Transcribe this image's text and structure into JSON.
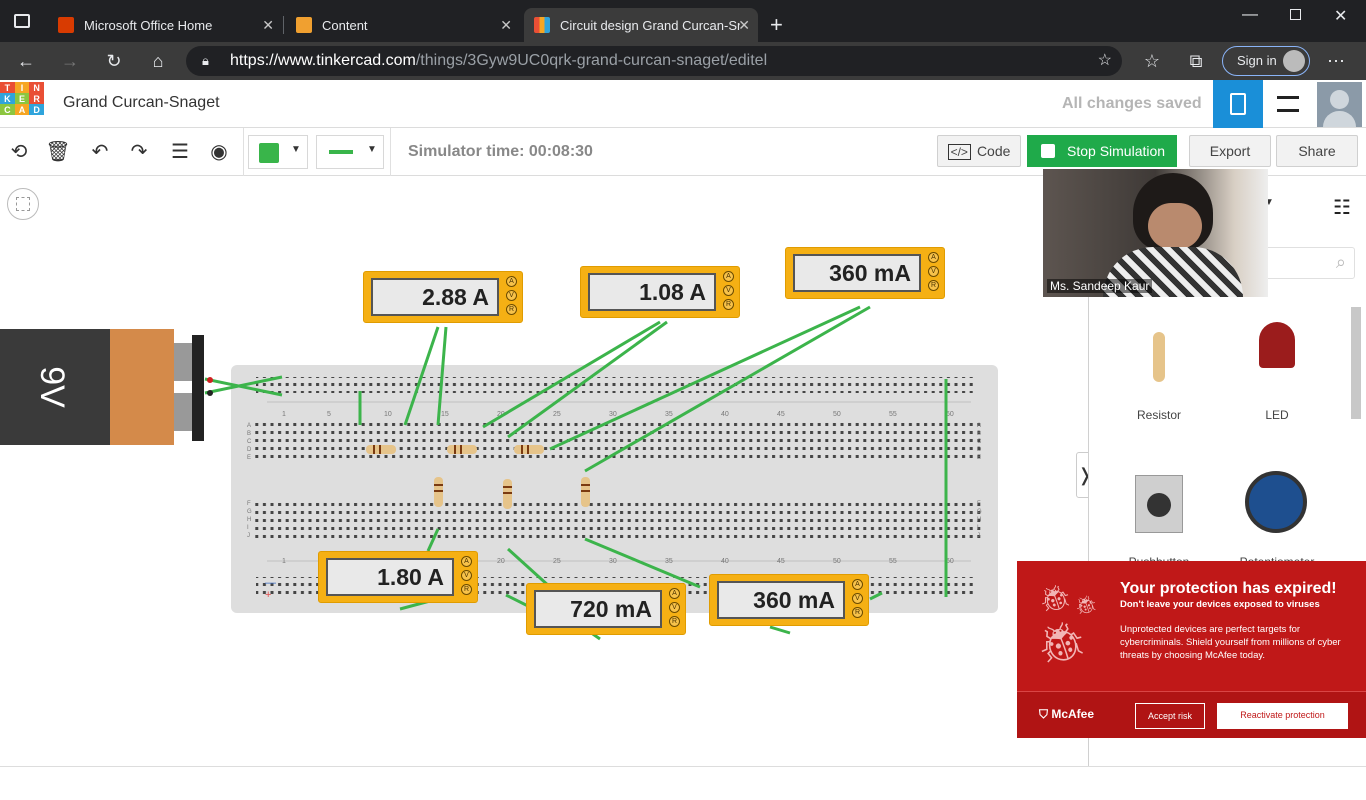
{
  "browser": {
    "tabs": [
      {
        "label": "Microsoft Office Home"
      },
      {
        "label": "Content"
      },
      {
        "label": "Circuit design Grand Curcan-Sna"
      }
    ],
    "url": {
      "host": "https://www.tinkercad.com",
      "path": "/things/3Gyw9UC0qrk-grand-curcan-snaget/editel"
    },
    "sign_in": "Sign in"
  },
  "header": {
    "logo_letters": [
      "T",
      "I",
      "N",
      "K",
      "E",
      "R",
      "C",
      "A",
      "D",
      "",
      "",
      ""
    ],
    "title": "Grand Curcan-Snaget",
    "save_status": "All changes saved"
  },
  "toolbar": {
    "simulator_time": "Simulator time: 00:08:30",
    "code_label": "Code",
    "stop_label": "Stop Simulation",
    "export_label": "Export",
    "share_label": "Share",
    "color_swatch": "#39b54a",
    "wire_color": "#39b54a"
  },
  "circuit": {
    "battery_label": "9V",
    "meters": [
      {
        "reading": "2.88 A"
      },
      {
        "reading": "1.08 A"
      },
      {
        "reading": "360 mA"
      },
      {
        "reading": "1.80 A"
      },
      {
        "reading": "720 mA"
      },
      {
        "reading": "360 mA"
      }
    ],
    "column_numbers": [
      "1",
      "5",
      "10",
      "15",
      "20",
      "25",
      "30",
      "35",
      "40",
      "45",
      "50",
      "55",
      "60"
    ],
    "row_letters_top": [
      "A",
      "B",
      "C",
      "D",
      "E"
    ],
    "row_letters_bottom": [
      "F",
      "G",
      "H",
      "I",
      "J"
    ]
  },
  "components": {
    "items": [
      {
        "label": "Resistor"
      },
      {
        "label": "LED"
      },
      {
        "label": "Pushbutton"
      },
      {
        "label": "Potentiometer"
      }
    ]
  },
  "video": {
    "name": "Ms. Sandeep Kaur"
  },
  "mcafee": {
    "title": "Your protection has expired!",
    "subtitle": "Don't leave your devices exposed to viruses",
    "body": "Unprotected devices are perfect targets for cybercriminals. Shield yourself from millions of cyber threats by choosing McAfee today.",
    "brand": "McAfee",
    "accept_label": "Accept risk",
    "reactivate_label": "Reactivate protection"
  }
}
